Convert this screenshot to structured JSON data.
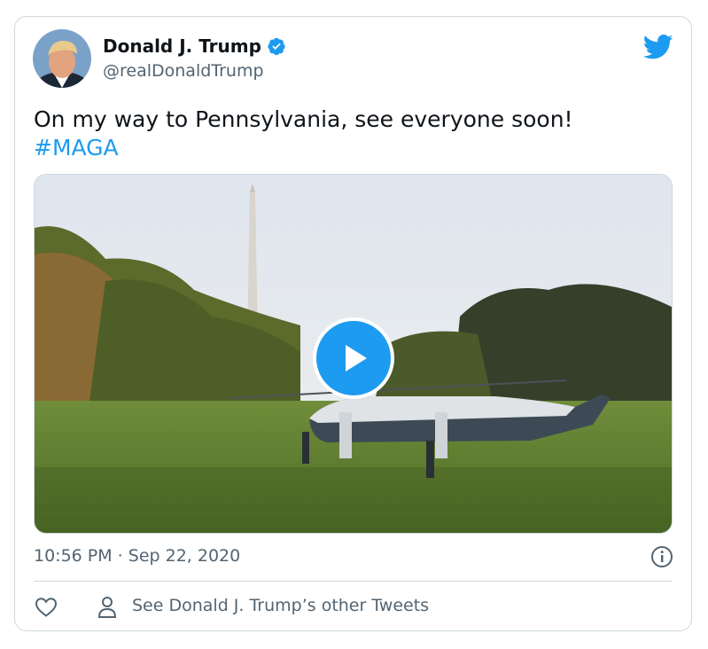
{
  "author": {
    "name": "Donald J. Trump",
    "handle": "@realDonaldTrump",
    "verified_icon": "verified-badge-icon",
    "avatar": "profile-avatar"
  },
  "tweet": {
    "text": "On my way to Pennsylvania, see everyone soon!",
    "hashtag": "#MAGA",
    "media": {
      "kind": "video",
      "play_icon": "play-icon"
    }
  },
  "meta": {
    "timestamp": "10:56 PM · Sep 22, 2020"
  },
  "actions": {
    "like_icon": "heart-icon",
    "other_tweets_label": "See Donald J. Trump’s other Tweets"
  },
  "colors": {
    "accent": "#1d9bf0",
    "secondary_text": "#536471",
    "border": "#cfd9de"
  }
}
